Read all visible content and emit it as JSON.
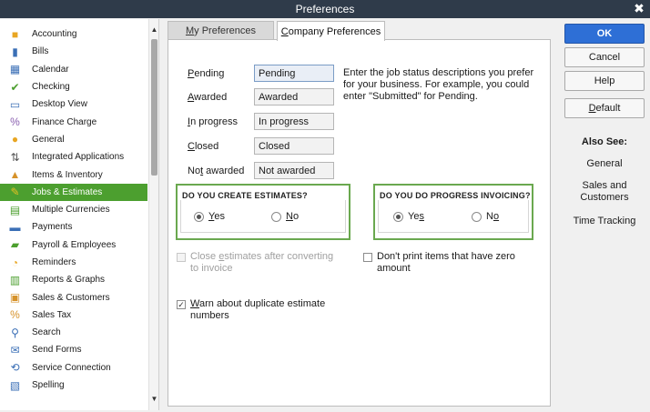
{
  "window": {
    "title": "Preferences",
    "close_glyph": "✖"
  },
  "sidebar": {
    "items": [
      {
        "label": "Accounting",
        "icon": "accounting-icon",
        "color": "#e8a623"
      },
      {
        "label": "Bills",
        "icon": "bills-icon",
        "color": "#3b6fb6"
      },
      {
        "label": "Calendar",
        "icon": "calendar-icon",
        "color": "#3b6fb6"
      },
      {
        "label": "Checking",
        "icon": "checking-icon",
        "color": "#4c9f2f"
      },
      {
        "label": "Desktop View",
        "icon": "desktop-view-icon",
        "color": "#3b6fb6"
      },
      {
        "label": "Finance Charge",
        "icon": "finance-charge-icon",
        "color": "#8a5fb0"
      },
      {
        "label": "General",
        "icon": "general-icon",
        "color": "#e8a623"
      },
      {
        "label": "Integrated Applications",
        "icon": "integrated-applications-icon",
        "color": "#555555"
      },
      {
        "label": "Items & Inventory",
        "icon": "items-inventory-icon",
        "color": "#d6922a"
      },
      {
        "label": "Jobs & Estimates",
        "icon": "jobs-estimates-icon",
        "color": "#e8c123"
      },
      {
        "label": "Multiple Currencies",
        "icon": "multiple-currencies-icon",
        "color": "#4c9f2f"
      },
      {
        "label": "Payments",
        "icon": "payments-icon",
        "color": "#3b6fb6"
      },
      {
        "label": "Payroll & Employees",
        "icon": "payroll-employees-icon",
        "color": "#4c9f2f"
      },
      {
        "label": "Reminders",
        "icon": "reminders-icon",
        "color": "#e8a623"
      },
      {
        "label": "Reports & Graphs",
        "icon": "reports-graphs-icon",
        "color": "#4c9f2f"
      },
      {
        "label": "Sales & Customers",
        "icon": "sales-customers-icon",
        "color": "#d6922a"
      },
      {
        "label": "Sales Tax",
        "icon": "sales-tax-icon",
        "color": "#d6922a"
      },
      {
        "label": "Search",
        "icon": "search-icon",
        "color": "#3b6fb6"
      },
      {
        "label": "Send Forms",
        "icon": "send-forms-icon",
        "color": "#3b6fb6"
      },
      {
        "label": "Service Connection",
        "icon": "service-connection-icon",
        "color": "#3b6fb6"
      },
      {
        "label": "Spelling",
        "icon": "spelling-icon",
        "color": "#3b6fb6"
      }
    ],
    "selected_index": 9,
    "selected_color": "#4c9f2f"
  },
  "tabs": {
    "my_preferences": {
      "accel": "M",
      "rest": "y Preferences"
    },
    "company_preferences": {
      "accel": "C",
      "rest": "ompany Preferences"
    }
  },
  "job_status": {
    "fields": [
      {
        "label_accel": "P",
        "label_rest": "ending",
        "value": "Pending"
      },
      {
        "label_accel": "A",
        "label_rest": "warded",
        "value": "Awarded"
      },
      {
        "label_accel": "I",
        "label_rest": "n progress",
        "value": "In progress"
      },
      {
        "label_accel": "C",
        "label_rest": "losed",
        "value": "Closed"
      },
      {
        "label_pre": "No",
        "label_accel": "t",
        "label_rest": " awarded",
        "value": "Not awarded"
      }
    ],
    "info": "Enter the job status descriptions you prefer for your business.  For example, you could enter \"Submitted\" for Pending."
  },
  "estimates_group": {
    "title": "DO YOU CREATE ESTIMATES?",
    "yes": {
      "accel": "Y",
      "rest": "es",
      "checked": true
    },
    "no": {
      "accel": "N",
      "rest": "o",
      "checked": false
    }
  },
  "progress_group": {
    "title": "DO YOU DO PROGRESS INVOICING?",
    "yes": {
      "pre": "Ye",
      "accel": "s",
      "rest": "",
      "checked": true
    },
    "no": {
      "pre": "N",
      "accel": "o",
      "rest": "",
      "checked": false
    }
  },
  "checkboxes": {
    "close_estimates": {
      "pre": "Close ",
      "accel": "e",
      "rest": "stimates after converting to invoice",
      "checked": false,
      "disabled": true
    },
    "dont_print": {
      "text": "Don't print items that have zero amount",
      "checked": false
    },
    "warn_duplicate": {
      "accel": "W",
      "rest": "arn about duplicate estimate numbers",
      "checked": true
    }
  },
  "buttons": {
    "ok": "OK",
    "cancel": "Cancel",
    "help": "Help",
    "default": {
      "accel": "D",
      "rest": "efault"
    }
  },
  "also_see": {
    "title": "Also See:",
    "links": [
      "General",
      "Sales and Customers",
      "Time Tracking"
    ]
  },
  "colors": {
    "accent_green": "#6aa84f",
    "ok_blue": "#2e6fd6",
    "titlebar": "#2f3b4a"
  }
}
